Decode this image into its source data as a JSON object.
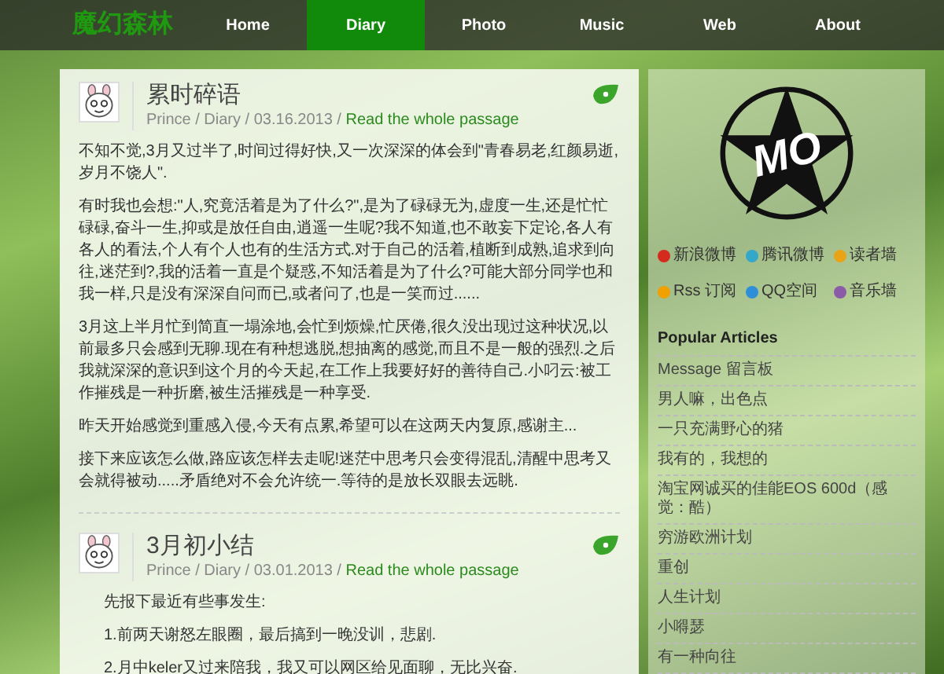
{
  "site": {
    "logo": "魔幻森林"
  },
  "nav": [
    {
      "label": "Home",
      "selected": false
    },
    {
      "label": "Diary",
      "selected": true
    },
    {
      "label": "Photo",
      "selected": false
    },
    {
      "label": "Music",
      "selected": false
    },
    {
      "label": "Web",
      "selected": false
    },
    {
      "label": "About",
      "selected": false
    }
  ],
  "posts": [
    {
      "title": "累时碎语",
      "meta": "Prince / Diary / 03.16.2013 / ",
      "link": "Read the whole passage",
      "paragraphs": [
        "不知不觉,3月又过半了,时间过得好快,又一次深深的体会到\"青春易老,红颜易逝,岁月不饶人\".",
        "有时我也会想:\"人,究竟活着是为了什么?\",是为了碌碌无为,虚度一生,还是忙忙碌碌,奋斗一生,抑或是放任自由,逍遥一生呢?我不知道,也不敢妄下定论,各人有各人的看法,个人有个人也有的生活方式.对于自己的活着,植断到成熟,追求到向往,迷茫到?,我的活着一直是个疑惑,不知活着是为了什么?可能大部分同学也和我一样,只是没有深深自问而已,或者问了,也是一笑而过......",
        "3月这上半月忙到简直一塌涂地,会忙到烦燥,忙厌倦,很久没出现过这种状况,以前最多只会感到无聊.现在有种想逃脱,想抽离的感觉,而且不是一般的强烈.之后我就深深的意识到这个月的今天起,在工作上我要好好的善待自己.小叼云:被工作摧残是一种折磨,被生活摧残是一种享受.",
        "昨天开始感觉到重感入侵,今天有点累,希望可以在这两天内复原,感谢主...",
        "接下来应该怎么做,路应该怎样去走呢!迷茫中思考只会变得混乱,清醒中思考又会就得被动.....矛盾绝对不会允许统一.等待的是放长双眼去远眺."
      ]
    },
    {
      "title": "3月初小结",
      "meta": "Prince / Diary / 03.01.2013 / ",
      "link": "Read the whole passage",
      "paragraphs": [
        "先报下最近有些事发生:",
        "1.前两天谢怒左眼圈，最后搞到一晚没训，悲剧.",
        "2.月中keler又过来陪我，我又可以网区给见面聊，无比兴奋."
      ]
    }
  ],
  "sidebar": {
    "logo_text": "MO",
    "social_links": [
      "新浪微博",
      "腾讯微博",
      "读者墙",
      "Rss 订阅",
      "QQ空间",
      "音乐墙"
    ],
    "popular": {
      "title": "Popular Articles",
      "items": [
        "Message 留言板",
        "男人嘛，出色点",
        "一只充满野心的猪",
        "我有的，我想的",
        "淘宝网诚买的佳能EOS 600d（感觉：酷）",
        "穷游欧洲计划",
        "重创",
        "人生计划",
        "小嘚瑟",
        "有一种向往"
      ]
    }
  }
}
